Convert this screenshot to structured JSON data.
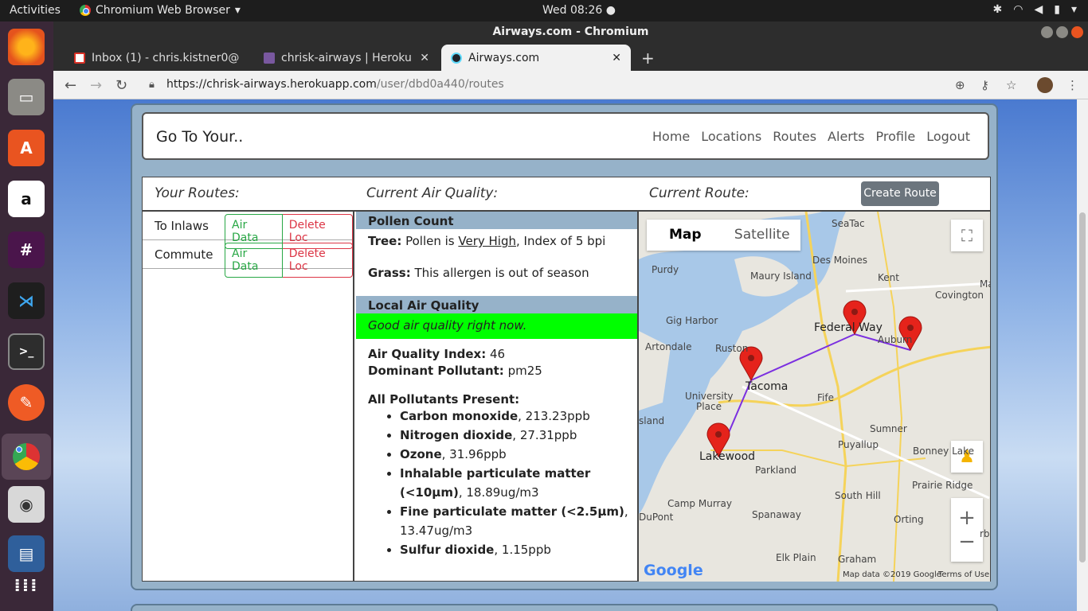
{
  "system": {
    "activities": "Activities",
    "app_name": "Chromium Web Browser",
    "clock": "Wed 08:26"
  },
  "browser": {
    "window_title": "Airways.com - Chromium",
    "tabs": [
      {
        "label": "Inbox (1) - chris.kistner0@"
      },
      {
        "label": "chrisk-airways | Heroku"
      },
      {
        "label": "Airways.com"
      }
    ],
    "url_host": "https://chrisk-airways.herokuapp.com",
    "url_path": "/user/dbd0a440/routes"
  },
  "nav": {
    "brand": "Go To Your..",
    "links": [
      "Home",
      "Locations",
      "Routes",
      "Alerts",
      "Profile",
      "Logout"
    ]
  },
  "headers": {
    "routes": "Your Routes:",
    "air_quality": "Current Air Quality:",
    "current_route": "Current Route:",
    "create_route": "Create Route"
  },
  "routes": [
    {
      "name": "To Inlaws",
      "air_data": "Air Data",
      "delete": "Delete Loc"
    },
    {
      "name": "Commute",
      "air_data": "Air Data",
      "delete": "Delete Loc"
    }
  ],
  "air": {
    "pollen_head": "Pollen Count",
    "tree_label": "Tree:",
    "tree_pre": " Pollen is ",
    "tree_level": "Very High",
    "tree_post": ", Index of 5 bpi",
    "grass_label": "Grass:",
    "grass_text": " This allergen is out of season",
    "local_head": "Local Air Quality",
    "status": "Good air quality right now.",
    "aqi_label": "Air Quality Index:",
    "aqi_value": " 46",
    "dominant_label": "Dominant Pollutant:",
    "dominant_value": " pm25",
    "pollutants_head": "All Pollutants Present:",
    "pollutants": [
      {
        "name": "Carbon monoxide",
        "value": ", 213.23ppb"
      },
      {
        "name": "Nitrogen dioxide",
        "value": ", 27.31ppb"
      },
      {
        "name": "Ozone",
        "value": ", 31.96ppb"
      },
      {
        "name": "Inhalable particulate matter (<10µm)",
        "value": ", 18.89ug/m3"
      },
      {
        "name": "Fine particulate matter (<2.5µm)",
        "value": ", 13.47ug/m3"
      },
      {
        "name": "Sulfur dioxide",
        "value": ", 1.15ppb"
      }
    ]
  },
  "map": {
    "toggle_map": "Map",
    "toggle_satellite": "Satellite",
    "labels": {
      "seatac": "SeaTac",
      "purdy": "Purdy",
      "des_moines": "Des Moines",
      "kent": "Kent",
      "maury": "Maury Island",
      "covington": "Covington",
      "gig_harbor": "Gig Harbor",
      "federal_way": "Federal Way",
      "auburn": "Auburn",
      "artondale": "Artondale",
      "ruston": "Ruston",
      "tacoma": "Tacoma",
      "fife": "Fife",
      "university_place": "University Place",
      "island": "sland",
      "sumner": "Sumner",
      "puyallup": "Puyallup",
      "bonney_lake": "Bonney Lake",
      "lakewood": "Lakewood",
      "parkland": "Parkland",
      "prairie_ridge": "Prairie Ridge",
      "south_hill": "South Hill",
      "camp_murray": "Camp Murray",
      "dupont": "DuPont",
      "spanaway": "Spanaway",
      "orting": "Orting",
      "elk_plain": "Elk Plain",
      "graham": "Graham",
      "ma": "Ma",
      "rb": "rb"
    },
    "google": "Google",
    "attribution": "Map data ©2019 Google",
    "terms": "Terms of Use",
    "accent": "#7b2fe0",
    "marker_color": "#e5231b"
  }
}
